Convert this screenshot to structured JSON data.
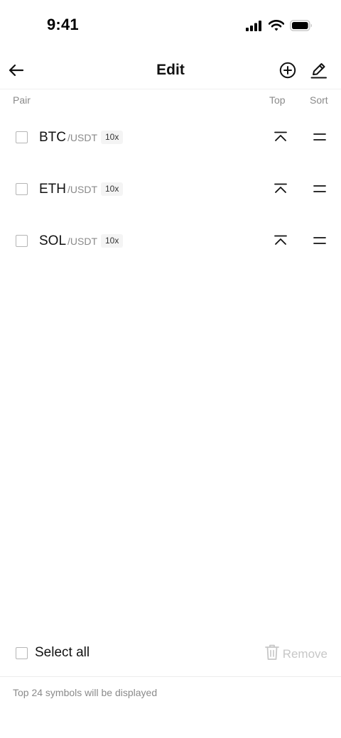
{
  "status_bar": {
    "time": "9:41",
    "icons": [
      "signal-icon",
      "wifi-icon",
      "battery-icon"
    ]
  },
  "nav": {
    "title": "Edit",
    "icons": [
      "back-arrow-icon",
      "add-circle-icon",
      "edit-pen-icon"
    ]
  },
  "columns": {
    "pair": "Pair",
    "top": "Top",
    "sort": "Sort"
  },
  "rows": [
    {
      "base": "BTC",
      "quote": "/USDT",
      "leverage": "10x"
    },
    {
      "base": "ETH",
      "quote": "/USDT",
      "leverage": "10x"
    },
    {
      "base": "SOL",
      "quote": "/USDT",
      "leverage": "10x"
    }
  ],
  "footer": {
    "select_all": "Select all",
    "remove": "Remove",
    "note": "Top 24 symbols will be displayed"
  },
  "colors": {
    "text": "#111111",
    "muted": "#8a8a8a",
    "disabled": "#c7c7c7",
    "badge_bg": "#f4f4f4"
  }
}
